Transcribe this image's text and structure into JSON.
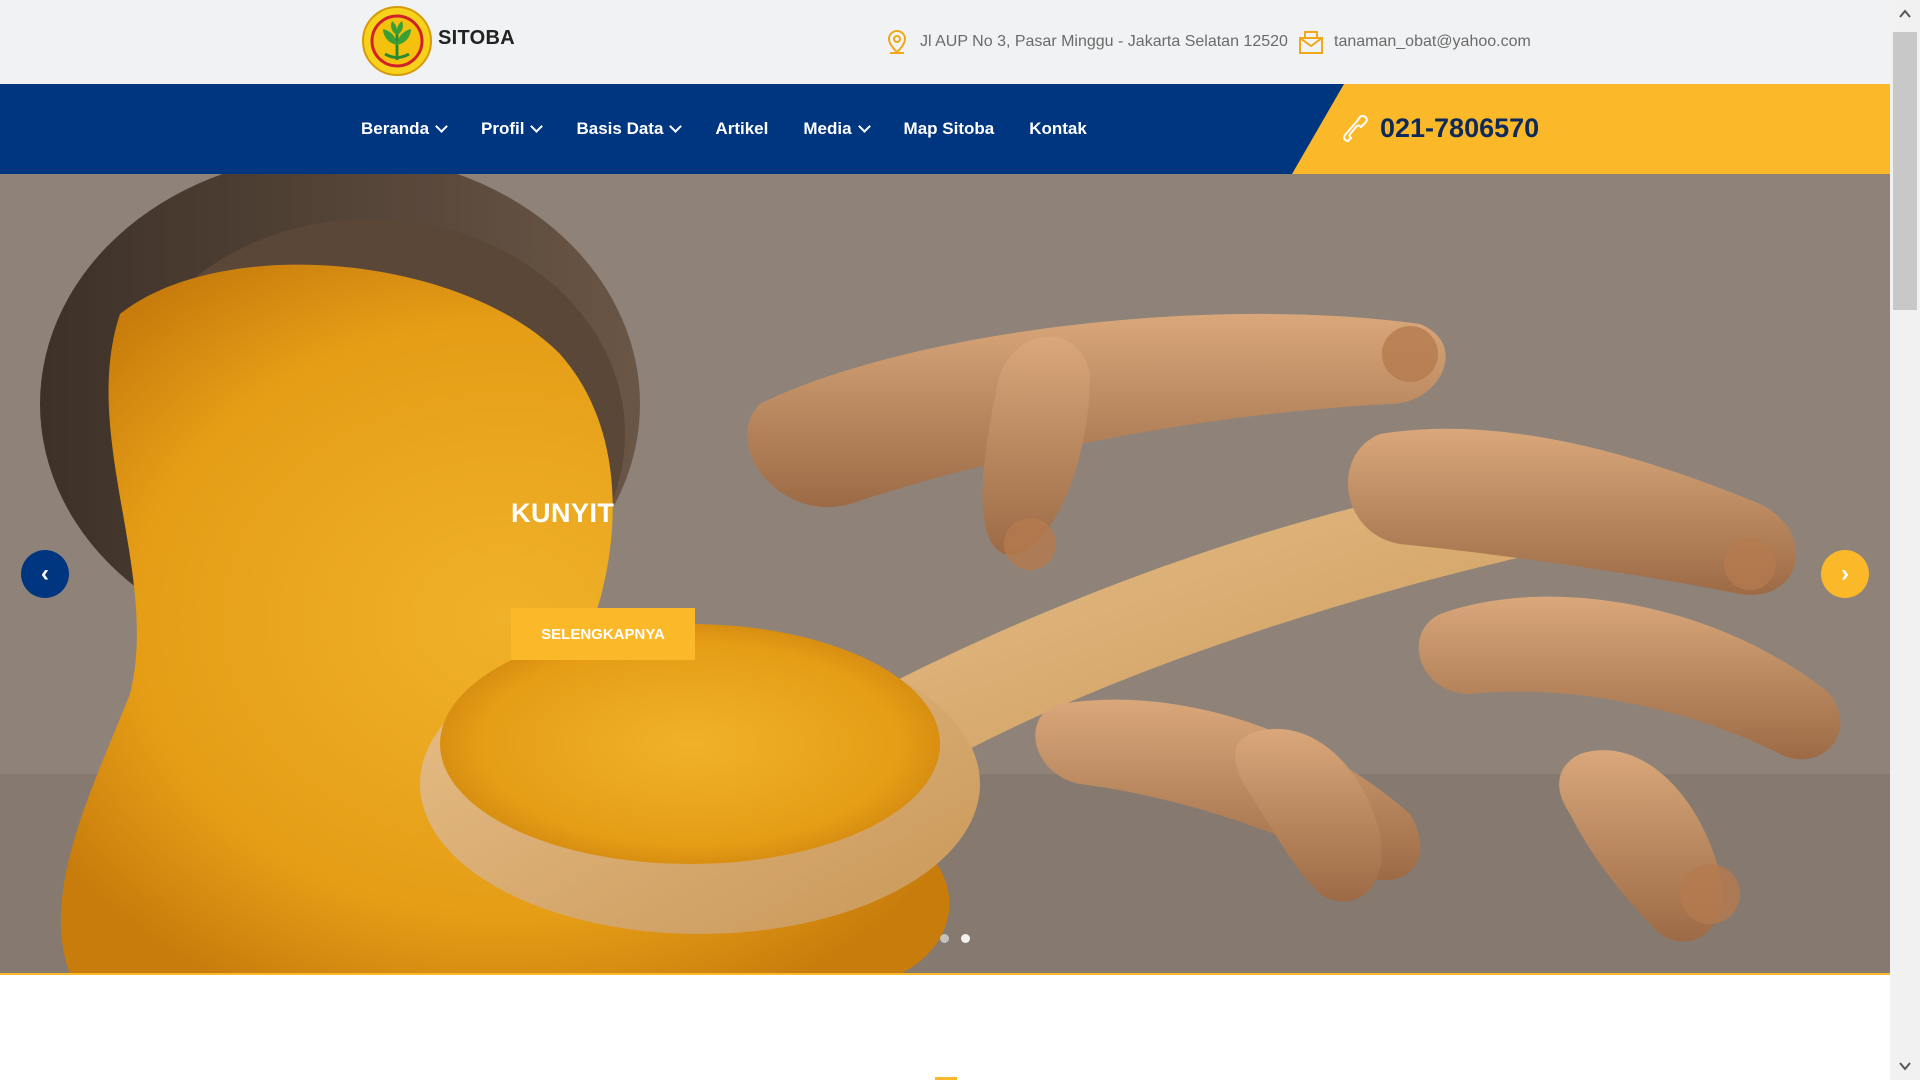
{
  "brand": {
    "name": "SITOBA",
    "logo_icon": "ministry-logo-icon"
  },
  "contact": {
    "address": "Jl AUP No 3, Pasar Minggu - Jakarta Selatan 12520",
    "address_icon": "location-pin-icon",
    "email": "tanaman_obat@yahoo.com",
    "email_icon": "envelope-icon"
  },
  "nav": {
    "items": [
      {
        "label": "Beranda",
        "dropdown": true
      },
      {
        "label": "Profil",
        "dropdown": true
      },
      {
        "label": "Basis Data",
        "dropdown": true
      },
      {
        "label": "Artikel",
        "dropdown": false
      },
      {
        "label": "Media",
        "dropdown": true
      },
      {
        "label": "Map Sitoba",
        "dropdown": false
      },
      {
        "label": "Kontak",
        "dropdown": false
      }
    ],
    "phone": "021-7806570",
    "phone_icon": "phone-icon"
  },
  "hero": {
    "title": "KUNYIT",
    "button_label": "SELENGKAPNYA",
    "prev_label": "‹",
    "next_label": "›",
    "slide_count": 2,
    "active_slide": 2
  },
  "colors": {
    "primary_navy": "#003580",
    "accent_yellow": "#fbb829",
    "topbar_bg": "#f1f2f3"
  }
}
